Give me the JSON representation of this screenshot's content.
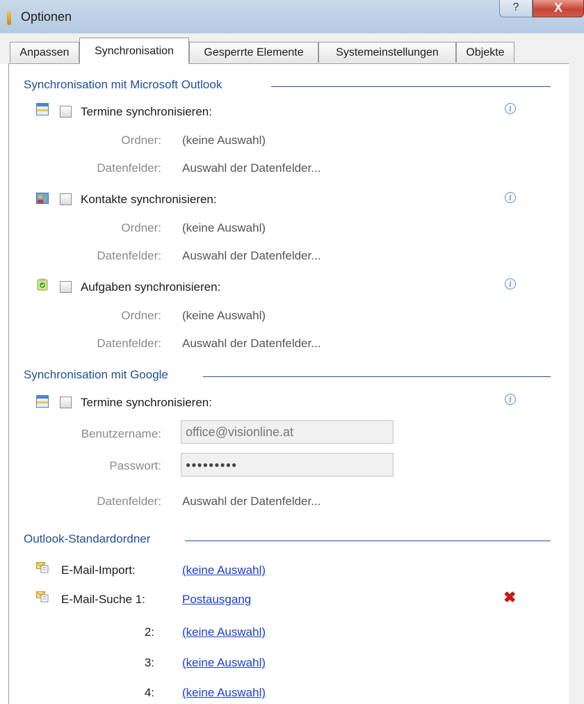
{
  "window": {
    "title": "Optionen",
    "help_label": "?",
    "close_label": "X"
  },
  "tabs": [
    "Anpassen",
    "Synchronisation",
    "Gesperrte Elemente",
    "Systemeinstellungen",
    "Objekte"
  ],
  "active_tab": "Synchronisation",
  "outlook": {
    "heading": "Synchronisation mit Microsoft Outlook",
    "termine": {
      "label": "Termine synchronisieren:",
      "ordner_label": "Ordner:",
      "ordner_value": "(keine Auswahl)",
      "datenfelder_label": "Datenfelder:",
      "datenfelder_value": "Auswahl der Datenfelder..."
    },
    "kontakte": {
      "label": "Kontakte synchronisieren:",
      "ordner_label": "Ordner:",
      "ordner_value": "(keine Auswahl)",
      "datenfelder_label": "Datenfelder:",
      "datenfelder_value": "Auswahl der Datenfelder..."
    },
    "aufgaben": {
      "label": "Aufgaben synchronisieren:",
      "ordner_label": "Ordner:",
      "ordner_value": "(keine Auswahl)",
      "datenfelder_label": "Datenfelder:",
      "datenfelder_value": "Auswahl der Datenfelder..."
    }
  },
  "google": {
    "heading": "Synchronisation mit Google",
    "termine_label": "Termine synchronisieren:",
    "benutzername_label": "Benutzername:",
    "benutzername_value": "office@visionline.at",
    "passwort_label": "Passwort:",
    "passwort_value": "●●●●●●●●●",
    "datenfelder_label": "Datenfelder:",
    "datenfelder_value": "Auswahl der Datenfelder..."
  },
  "standard": {
    "heading": "Outlook-Standardordner",
    "import_label": "E-Mail-Import:",
    "import_value": "(keine Auswahl)",
    "suche_label": "E-Mail-Suche 1:",
    "suche_values": [
      "Postausgang",
      "(keine Auswahl)",
      "(keine Auswahl)",
      "(keine Auswahl)"
    ],
    "suche_numbers": [
      "2:",
      "3:",
      "4:"
    ]
  },
  "info_glyph": "i",
  "remove_glyph": "✖",
  "icons": {
    "app": "options-app-icon",
    "calendar": "calendar-icon",
    "contacts": "contacts-icon",
    "tasks": "tasks-icon",
    "mail": "mail-icon",
    "info": "info-icon",
    "remove": "remove-x-icon"
  },
  "colors": {
    "section_heading": "#1f4f9b",
    "link": "#1c3fd0",
    "remove": "#c41a1a"
  }
}
